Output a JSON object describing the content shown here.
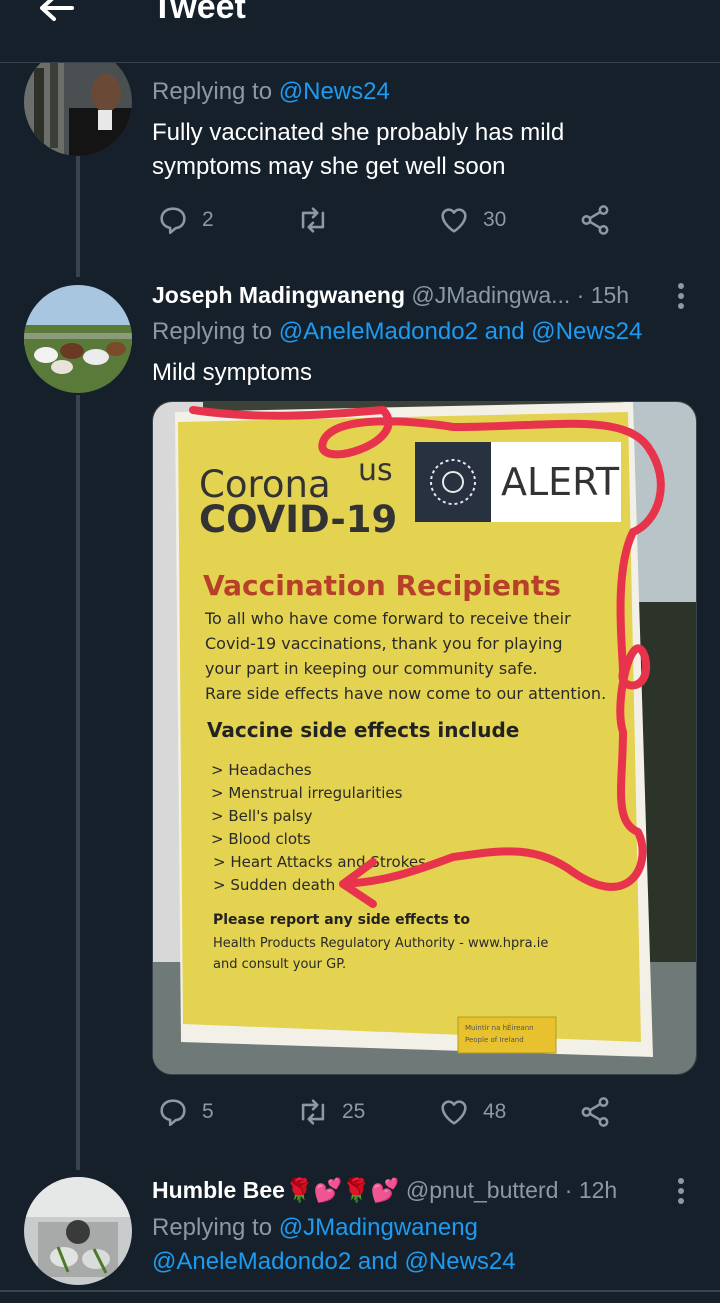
{
  "header": {
    "title": "Tweet"
  },
  "tweets": [
    {
      "replying_prefix": "Replying to",
      "replying_to": "@News24",
      "text_lines": [
        "Fully vaccinated she probably has mild",
        "symptoms may she get well soon"
      ],
      "replies": "2",
      "retweets": "",
      "likes": "30"
    },
    {
      "name": "Joseph Madingwaneng",
      "handle": "@JMadingwa...",
      "time": "· 15h",
      "replying_prefix": "Replying to",
      "replying_to": "@AneleMadondo2 and @News24",
      "text": "Mild symptoms",
      "replies": "5",
      "retweets": "25",
      "likes": "48",
      "media": {
        "title_line1": "Corona",
        "title_line1_tail": "us",
        "title_line2": "COVID-19",
        "alert": "ALERT",
        "heading": "Vaccination Recipients",
        "intro": [
          "To all who have come forward to receive their",
          "Covid-19 vaccinations, thank you for playing",
          "your part in keeping our community safe.",
          "Rare side effects have now come to our attention."
        ],
        "subheading": "Vaccine side effects include",
        "effects": [
          "> Headaches",
          "> Menstrual irregularities",
          "> Bell's palsy",
          "> Blood clots",
          "> Heart Attacks and Strokes",
          "> Sudden death"
        ],
        "report_bold": "Please report any side effects to",
        "report_lines": [
          "Health Products Regulatory Authority - www.hpra.ie",
          "and consult your GP."
        ],
        "footer_tag": [
          "Muintir na hÉireann",
          "People of Ireland"
        ]
      }
    },
    {
      "name": "Humble Bee",
      "emoji": "🌹💕🌹💕",
      "handle": "@pnut_butterd",
      "time": "· 12h",
      "replying_prefix": "Replying to",
      "replying_line1": "@JMadingwaneng",
      "replying_line2": "@AneleMadondo2 and @News24"
    }
  ],
  "colors": {
    "background": "#15202b",
    "accent": "#1d9bf0",
    "muted": "#8b98a5",
    "divider": "#38444d"
  }
}
